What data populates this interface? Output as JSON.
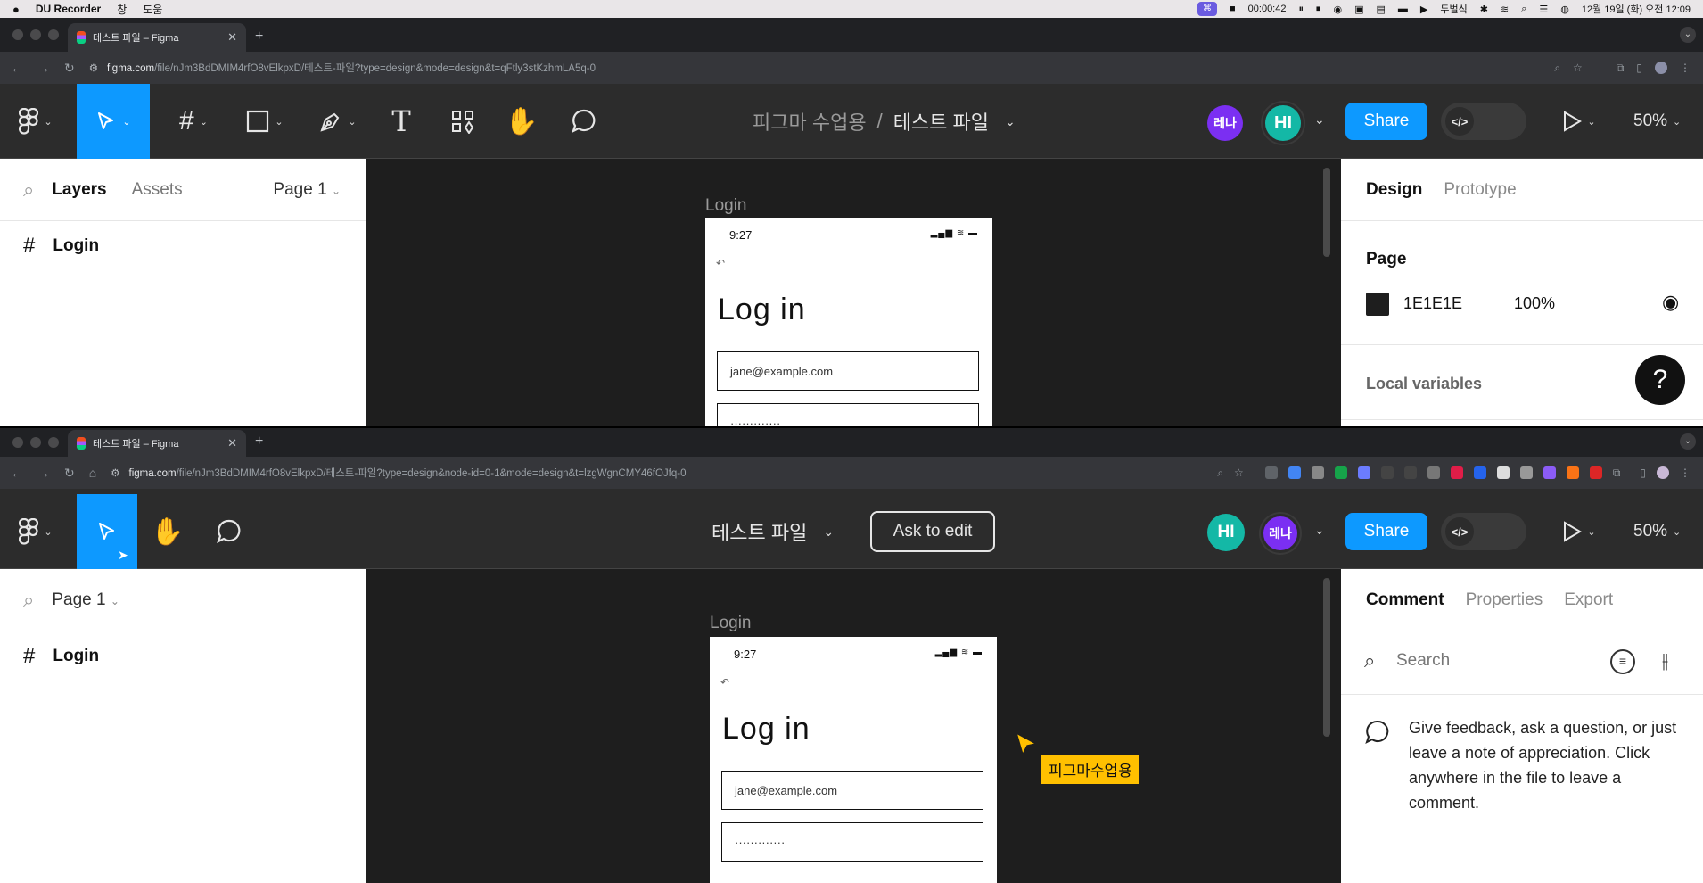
{
  "menubar": {
    "app": "DU Recorder",
    "menu1": "창",
    "menu2": "도움",
    "rec_badge": "⌘",
    "timer": "00:00:42",
    "input_source": "두벌식",
    "datetime": "12월 19일 (화) 오전 12:09"
  },
  "top": {
    "tab_title": "테스트 파일 – Figma",
    "url_host": "figma.com",
    "url_rest": "/file/nJm3BdDMIM4rfO8vElkpxD/테스트-파일?type=design&mode=design&t=qFtly3stKzhmLA5q-0",
    "breadcrumb_team": "피그마 수업용",
    "breadcrumb_sep": "/",
    "file_name": "테스트 파일",
    "avatar1": "레나",
    "avatar2": "HI",
    "share": "Share",
    "zoom": "50%",
    "layers_tab": "Layers",
    "assets_tab": "Assets",
    "page_select": "Page 1",
    "layer_item": "Login",
    "frame_label": "Login",
    "phone_time": "9:27",
    "phone_title": "Log in",
    "email_value": "jane@example.com",
    "password_value": "·············",
    "design_tab": "Design",
    "prototype_tab": "Prototype",
    "page_heading": "Page",
    "bg_hex": "1E1E1E",
    "bg_opacity": "100%",
    "local_variables": "Local variables",
    "help": "?"
  },
  "bottom": {
    "tab_title": "테스트 파일 – Figma",
    "url_host": "figma.com",
    "url_rest": "/file/nJm3BdDMIM4rfO8vElkpxD/테스트-파일?type=design&node-id=0-1&mode=design&t=lzgWgnCMY46fOJfq-0",
    "file_name": "테스트 파일",
    "ask_to_edit": "Ask to edit",
    "avatar1": "HI",
    "avatar2": "레나",
    "share": "Share",
    "zoom": "50%",
    "page_select": "Page 1",
    "layer_item": "Login",
    "frame_label": "Login",
    "phone_time": "9:27",
    "phone_title": "Log in",
    "email_value": "jane@example.com",
    "password_value": "·············",
    "comment_tab": "Comment",
    "properties_tab": "Properties",
    "export_tab": "Export",
    "search_placeholder": "Search",
    "comment_hint": "Give feedback, ask a question, or just leave a note of appreciation. Click anywhere in the file to leave a comment.",
    "cursor_label": "피그마수업용"
  },
  "colors": {
    "figma_blue": "#0d99ff",
    "avatar_purple": "#7b2ff2",
    "avatar_teal": "#14b8a6",
    "cursor_yellow": "#ffc000"
  }
}
